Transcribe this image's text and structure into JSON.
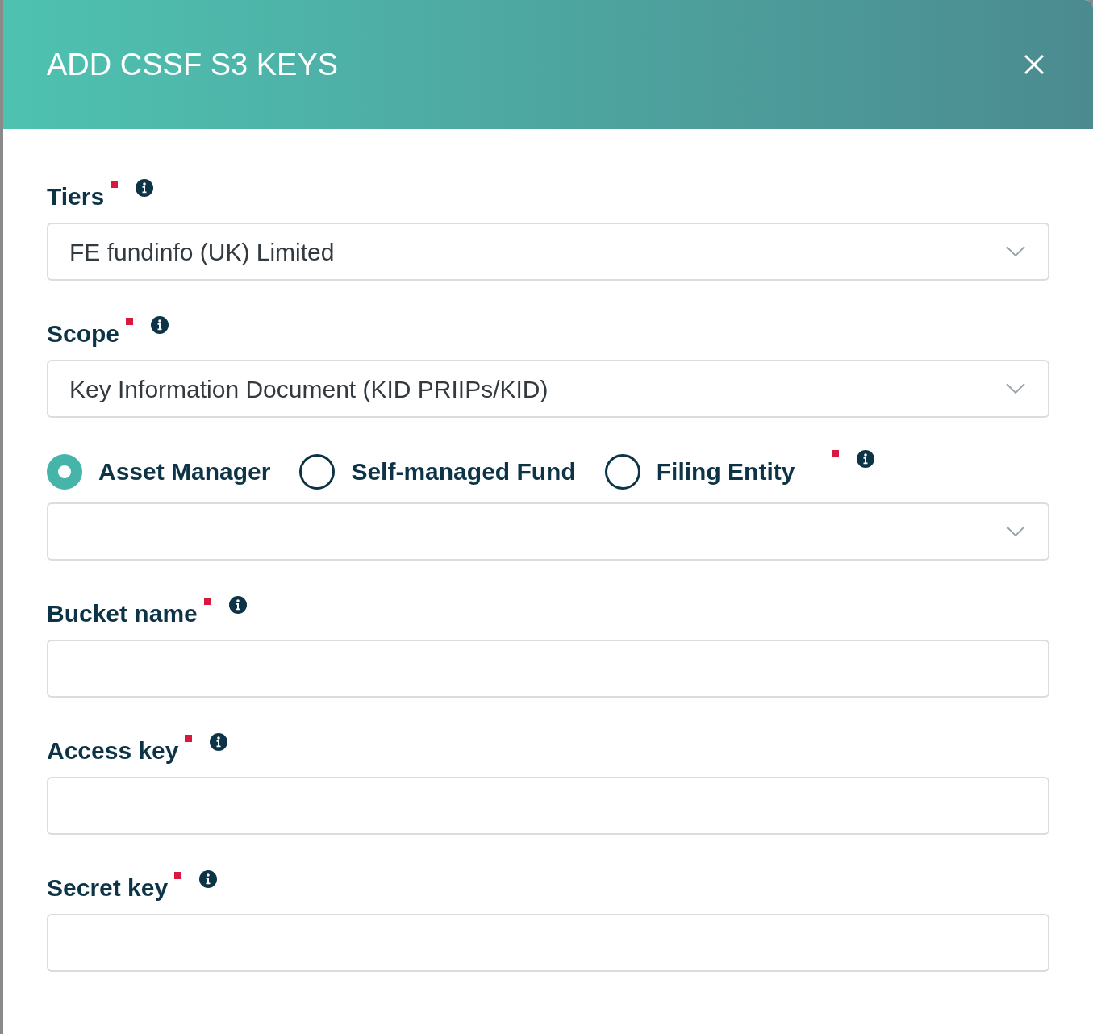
{
  "dialog": {
    "title": "ADD CSSF S3 KEYS"
  },
  "fields": [
    {
      "kind": "select",
      "label": "Tiers",
      "required": true,
      "value": "FE fundinfo (UK) Limited"
    },
    {
      "kind": "select",
      "label": "Scope",
      "required": true,
      "value": "Key Information Document (KID PRIIPs/KID)"
    },
    {
      "kind": "radio-select",
      "required": true,
      "options": [
        {
          "label": "Asset Manager",
          "selected": true
        },
        {
          "label": "Self-managed Fund",
          "selected": false
        },
        {
          "label": "Filing Entity",
          "selected": false
        }
      ]
    },
    {
      "kind": "text",
      "label": "Bucket name",
      "required": true
    },
    {
      "kind": "text",
      "label": "Access key",
      "required": true
    },
    {
      "kind": "text",
      "label": "Secret key",
      "required": true
    }
  ]
}
